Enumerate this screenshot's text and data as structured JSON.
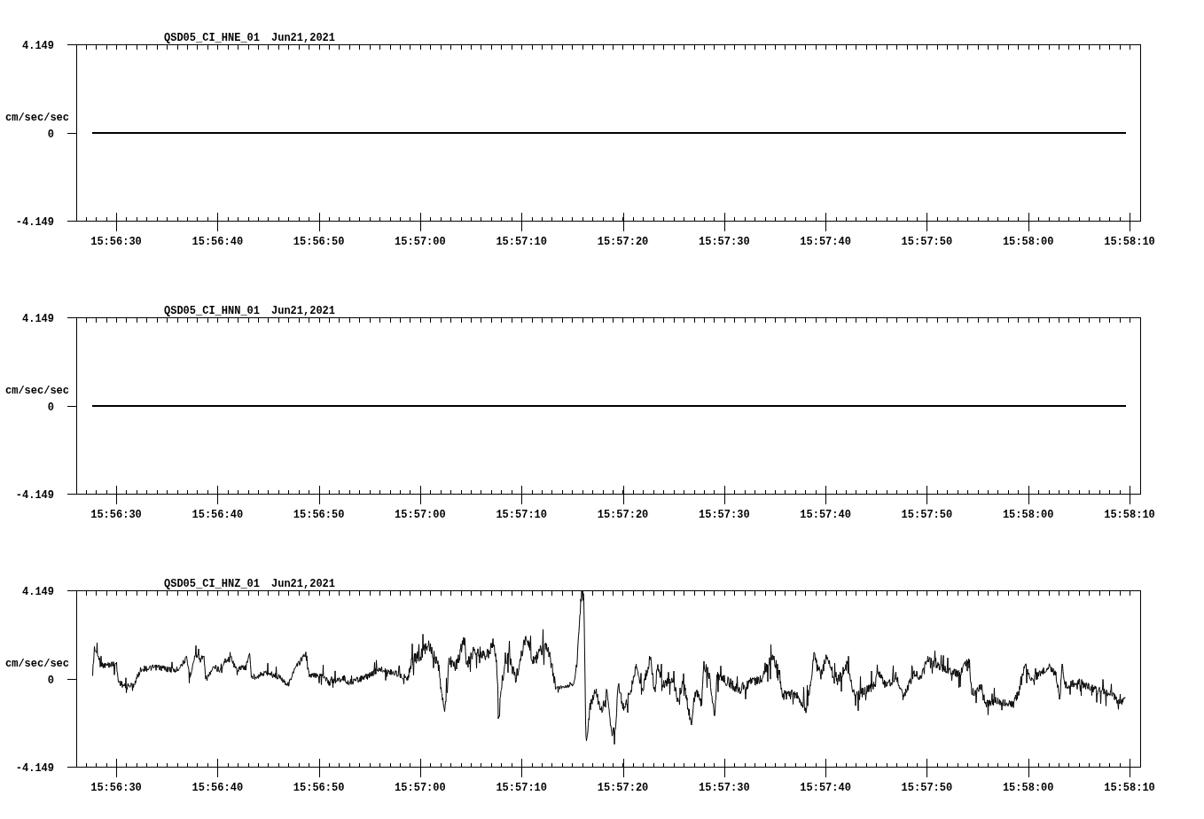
{
  "panels": [
    {
      "station": "QSD05_CI_HNE_01",
      "date": "Jun21,2021",
      "y_unit": "cm/sec/sec",
      "y_ticks": [
        "4.149",
        "0",
        "-4.149"
      ],
      "x_ticks": [
        "15:56:30",
        "15:56:40",
        "15:56:50",
        "15:57:00",
        "15:57:10",
        "15:57:20",
        "15:57:30",
        "15:57:40",
        "15:57:50",
        "15:58:00",
        "15:58:10"
      ],
      "kind": "flat"
    },
    {
      "station": "QSD05_CI_HNN_01",
      "date": "Jun21,2021",
      "y_unit": "cm/sec/sec",
      "y_ticks": [
        "4.149",
        "0",
        "-4.149"
      ],
      "x_ticks": [
        "15:56:30",
        "15:56:40",
        "15:56:50",
        "15:57:00",
        "15:57:10",
        "15:57:20",
        "15:57:30",
        "15:57:40",
        "15:57:50",
        "15:58:00",
        "15:58:10"
      ],
      "kind": "flat"
    },
    {
      "station": "QSD05_CI_HNZ_01",
      "date": "Jun21,2021",
      "y_unit": "cm/sec/sec",
      "y_ticks": [
        "4.149",
        "0",
        "-4.149"
      ],
      "x_ticks": [
        "15:56:30",
        "15:56:40",
        "15:56:50",
        "15:57:00",
        "15:57:10",
        "15:57:20",
        "15:57:30",
        "15:57:40",
        "15:57:50",
        "15:58:00",
        "15:58:10"
      ],
      "kind": "signal"
    }
  ]
}
